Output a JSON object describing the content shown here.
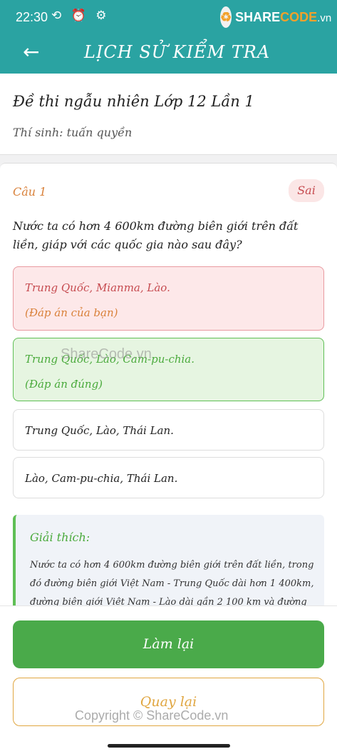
{
  "status": {
    "time": "22:30",
    "icons": "⟲ ⏰ ⚙"
  },
  "brand": {
    "logo_glyph": "♻",
    "share": "SHARE",
    "code": "CODE",
    "suffix": ".vn"
  },
  "appbar": {
    "back_icon": "←",
    "title": "LỊCH SỬ KIỂM TRA"
  },
  "exam": {
    "name": "Đề thi ngẫu nhiên Lớp 12 Lần 1",
    "candidate": "Thí sinh: tuấn quyền"
  },
  "question": {
    "label": "Câu 1",
    "status": "Sai",
    "text": "Nước ta có hơn 4 600km đường biên giới trên đất liền, giáp với các quốc gia nào sau đây?",
    "answers": [
      {
        "text": "Trung Quốc, Mianma, Lào.",
        "tag": "(Đáp án của bạn)"
      },
      {
        "text": "Trung Quốc, Lào, Cam-pu-chia.",
        "tag": "(Đáp án đúng)"
      },
      {
        "text": "Trung Quốc, Lào, Thái Lan."
      },
      {
        "text": "Lào, Cam-pu-chia, Thái Lan."
      }
    ],
    "explanation": {
      "title": "Giải thích:",
      "text": "Nước ta có hơn 4 600km đường biên giới trên đất liền, trong đó đường biên giới Việt Nam - Trung Quốc dài hơn 1 400km, đường biên giới Việt Nam - Lào dài gần 2 100 km và đường"
    }
  },
  "buttons": {
    "redo": "Làm lại",
    "back": "Quay lại"
  },
  "watermarks": {
    "center": "ShareCode.vn",
    "bottom": "Copyright © ShareCode.vn"
  },
  "colors": {
    "primary": "#2aa3a2",
    "wrong": "#c64b50",
    "correct": "#4aaa3c",
    "accent": "#e0a640"
  }
}
